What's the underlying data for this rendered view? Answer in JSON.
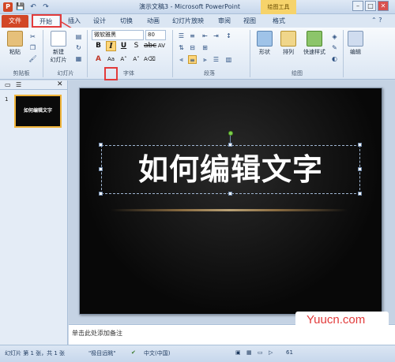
{
  "titlebar": {
    "app_icon": "P",
    "title": "演示文稿3 - Microsoft PowerPoint",
    "context_tools": "绘图工具",
    "qa_save": "💾",
    "qa_undo": "↶",
    "qa_redo": "↷",
    "win_min": "–",
    "win_max": "□",
    "win_close": "✕"
  },
  "tabs": [
    {
      "label": "文件"
    },
    {
      "label": "开始"
    },
    {
      "label": "插入"
    },
    {
      "label": "设计"
    },
    {
      "label": "切换"
    },
    {
      "label": "动画"
    },
    {
      "label": "幻灯片放映"
    },
    {
      "label": "审阅"
    },
    {
      "label": "视图"
    },
    {
      "label": "格式"
    }
  ],
  "ribbon": {
    "clipboard": {
      "paste": "粘贴",
      "group": "剪贴板"
    },
    "slides": {
      "new_slide": "新建\n幻灯片",
      "new_slide_label": "新建",
      "slide_sub": "幻灯片",
      "group": "幻灯片"
    },
    "font": {
      "font_name": "微软雅黑",
      "font_size": "80",
      "bold": "B",
      "italic": "I",
      "group": "字体"
    },
    "paragraph": {
      "group": "段落"
    },
    "drawing": {
      "shapes": "形状",
      "arrange": "排列",
      "quick_styles": "快速样式",
      "group": "绘图"
    },
    "editing": {
      "label": "编辑"
    }
  },
  "left_pane": {
    "slide_number": "1",
    "thumb_text": "如何编辑文字",
    "close": "✕"
  },
  "slide": {
    "title": "如何编辑文字"
  },
  "notes": {
    "placeholder": "单击此处添加备注"
  },
  "watermark": {
    "text": "Yuucn.com"
  },
  "status": {
    "slide_info": "幻灯片 第 1 张，共 1 张",
    "theme": "\"极目远眺\"",
    "language": "中文(中国)",
    "zoom": "61"
  },
  "colors": {
    "file_tab": "#d24726",
    "highlight": "#e23b3b",
    "italic_active": "#ffd67a"
  }
}
